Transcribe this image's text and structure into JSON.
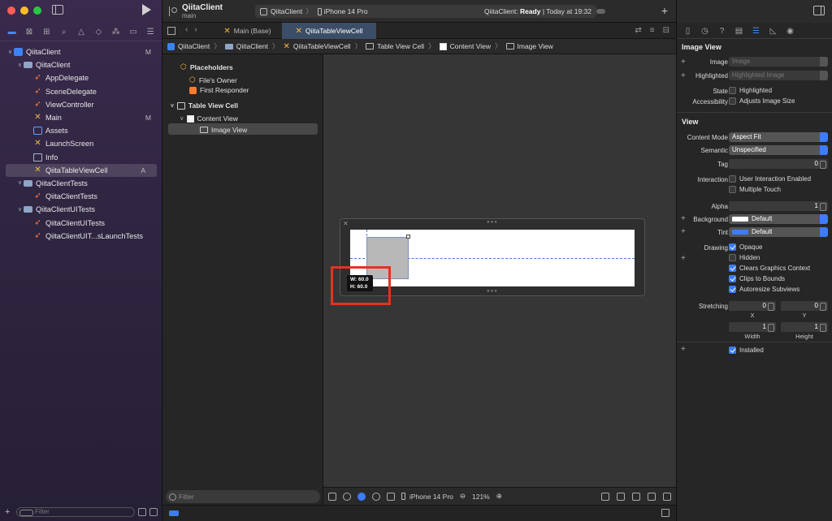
{
  "navigator": {
    "tree": [
      {
        "label": "QiitaClient",
        "icon": "project-icon",
        "level": 0,
        "disclosure": "v",
        "badge": "M"
      },
      {
        "label": "QiitaClient",
        "icon": "folder-icon",
        "level": 1,
        "disclosure": "v",
        "badge": ""
      },
      {
        "label": "AppDelegate",
        "icon": "swift-icon",
        "level": 2,
        "disclosure": "",
        "badge": ""
      },
      {
        "label": "SceneDelegate",
        "icon": "swift-icon",
        "level": 2,
        "disclosure": "",
        "badge": ""
      },
      {
        "label": "ViewController",
        "icon": "swift-icon",
        "level": 2,
        "disclosure": "",
        "badge": ""
      },
      {
        "label": "Main",
        "icon": "xib-icon",
        "level": 2,
        "disclosure": "",
        "badge": "M"
      },
      {
        "label": "Assets",
        "icon": "assets-icon",
        "level": 2,
        "disclosure": "",
        "badge": ""
      },
      {
        "label": "LaunchScreen",
        "icon": "xib-icon",
        "level": 2,
        "disclosure": "",
        "badge": ""
      },
      {
        "label": "Info",
        "icon": "plist-icon",
        "level": 2,
        "disclosure": "",
        "badge": ""
      },
      {
        "label": "QiitaTableViewCell",
        "icon": "xib-icon",
        "level": 2,
        "disclosure": "",
        "badge": "A",
        "selected": true
      },
      {
        "label": "QiitaClientTests",
        "icon": "folder-icon",
        "level": 1,
        "disclosure": "v",
        "badge": ""
      },
      {
        "label": "QiitaClientTests",
        "icon": "swift-icon",
        "level": 2,
        "disclosure": "",
        "badge": ""
      },
      {
        "label": "QiitaClientUITests",
        "icon": "folder-icon",
        "level": 1,
        "disclosure": "v",
        "badge": ""
      },
      {
        "label": "QiitaClientUITests",
        "icon": "swift-icon",
        "level": 2,
        "disclosure": "",
        "badge": ""
      },
      {
        "label": "QiitaClientUIT...sLaunchTests",
        "icon": "swift-icon",
        "level": 2,
        "disclosure": "",
        "badge": ""
      }
    ],
    "filter_placeholder": "Filter"
  },
  "toolbar": {
    "project": "QiitaClient",
    "branch": "main",
    "scheme_target": "QiitaClient",
    "device": "iPhone 14 Pro",
    "status_prefix": "QiitaClient: ",
    "status_state": "Ready",
    "status_time": " | Today at 19:32"
  },
  "tabs": [
    {
      "label": "Main (Base)",
      "active": false
    },
    {
      "label": "QiitaTableViewCell",
      "active": true
    }
  ],
  "jumpbar": [
    "QiitaClient",
    "QiitaClient",
    "QiitaTableViewCell",
    "Table View Cell",
    "Content View",
    "Image View"
  ],
  "outline": {
    "placeholders": "Placeholders",
    "files_owner": "File's Owner",
    "first_responder": "First Responder",
    "table_view_cell": "Table View Cell",
    "content_view": "Content View",
    "image_view": "Image View",
    "filter_placeholder": "Filter"
  },
  "canvas": {
    "size_w": "W:   60.0",
    "size_h": "H:   60.0",
    "device": "iPhone 14 Pro",
    "zoom": "121%"
  },
  "inspector": {
    "image_view_title": "Image View",
    "image_label": "Image",
    "image_value": "Image",
    "highlighted_label": "Highlighted",
    "highlighted_value": "Highlighted Image",
    "state_label": "State",
    "state_check": "Highlighted",
    "accessibility_label": "Accessibility",
    "accessibility_check": "Adjusts Image Size",
    "view_title": "View",
    "content_mode_label": "Content Mode",
    "content_mode_value": "Aspect Fit",
    "semantic_label": "Semantic",
    "semantic_value": "Unspecified",
    "tag_label": "Tag",
    "tag_value": "0",
    "interaction_label": "Interaction",
    "user_interaction": "User Interaction Enabled",
    "multiple_touch": "Multiple Touch",
    "alpha_label": "Alpha",
    "alpha_value": "1",
    "background_label": "Background",
    "background_value": "Default",
    "tint_label": "Tint",
    "tint_value": "Default",
    "drawing_label": "Drawing",
    "opaque": "Opaque",
    "hidden": "Hidden",
    "clears_graphics": "Clears Graphics Context",
    "clips_to_bounds": "Clips to Bounds",
    "autoresize": "Autoresize Subviews",
    "stretching_label": "Stretching",
    "stretch_x": "0",
    "stretch_y": "0",
    "stretch_w": "1",
    "stretch_h": "1",
    "x_label": "X",
    "y_label": "Y",
    "width_label": "Width",
    "height_label": "Height",
    "installed": "Installed"
  },
  "colors": {
    "accent": "#3d7bff",
    "highlight_box": "#e0351f"
  }
}
